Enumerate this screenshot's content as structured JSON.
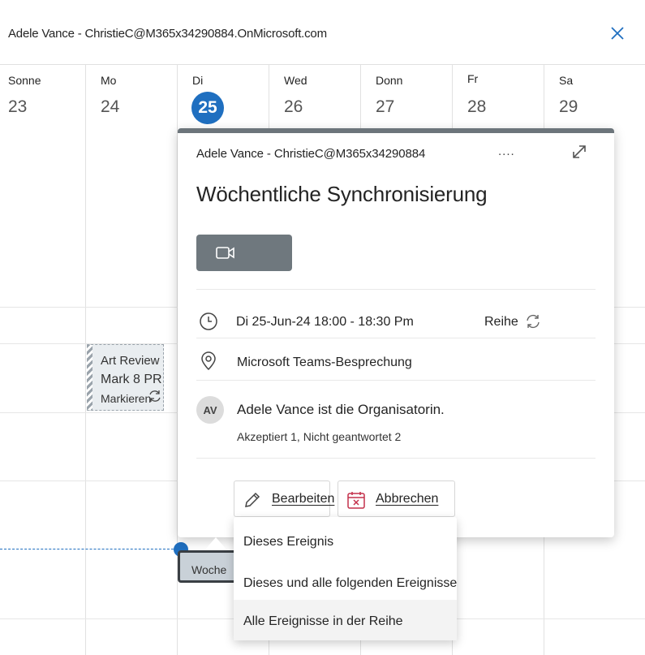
{
  "header": {
    "title": "Adele Vance - ChristieC@M365x34290884.OnMicrosoft.com"
  },
  "week": {
    "days": [
      {
        "name": "Sonne",
        "num": "23"
      },
      {
        "name": "Mo",
        "num": "24"
      },
      {
        "name": "Di",
        "num": "25"
      },
      {
        "name": "Wed",
        "num": "26"
      },
      {
        "name": "Donn",
        "num": "27"
      },
      {
        "name": "Fr",
        "num": "28"
      },
      {
        "name": "Sa",
        "num": "29"
      }
    ],
    "today_index": 2
  },
  "events": {
    "art_review": {
      "line1": "Art Review",
      "line2": "Mark 8 PR",
      "line3": "Markieren"
    },
    "weekly_short": "Woche"
  },
  "card": {
    "organizer_line": "Adele Vance - ChristieC@M365x34290884",
    "more": "....",
    "title": "Wöchentliche Synchronisierung",
    "when": "Di 25-Jun-24 18:00 - 18:30 Pm",
    "series_label": "Reihe",
    "location": "Microsoft Teams-Besprechung",
    "avatar_initials": "AV",
    "organizer_text": "Adele Vance ist die Organisatorin.",
    "response_status": "Akzeptiert 1, Nicht geantwortet 2",
    "edit_label": "Bearbeiten",
    "cancel_label": "Abbrechen"
  },
  "dropdown": {
    "items": [
      "Dieses Ereignis",
      "Dieses und alle folgenden Ereignisse",
      "Alle Ereignisse in der Reihe"
    ],
    "highlighted_index": 2
  },
  "colors": {
    "accent": "#1f6fc0",
    "card_bar": "#6c757b",
    "join_button": "#6f787e",
    "cancel_icon": "#c4314b"
  }
}
